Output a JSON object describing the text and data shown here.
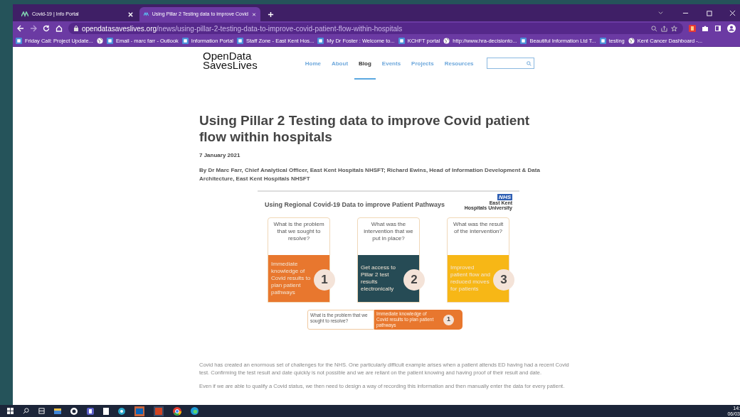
{
  "browser": {
    "tabs": [
      {
        "title": "Covid-19 | Info Portal",
        "selected": false
      },
      {
        "title": "Using Pillar 2 Testing data to improve Covid",
        "selected": true
      }
    ],
    "url": {
      "domain": "opendatasaveslives.org",
      "path": "/news/using-pillar-2-testing-data-to-improve-covid-patient-flow-within-hospitals"
    },
    "bookmarks": [
      {
        "kind": "site",
        "label": "Friday Call: Project Update..."
      },
      {
        "kind": "globe"
      },
      {
        "kind": "site",
        "label": "Email - marc farr - Outlook"
      },
      {
        "kind": "site",
        "label": "Information Portal"
      },
      {
        "kind": "site",
        "label": "Staff Zone - East Kent Hos..."
      },
      {
        "kind": "site",
        "label": "My Dr Foster : Welcome to..."
      },
      {
        "kind": "site",
        "label": "KCHFT portal"
      },
      {
        "kind": "globe",
        "label": "http://www.hra-decisionto..."
      },
      {
        "kind": "site",
        "label": "Beautiful Information Ltd T..."
      },
      {
        "kind": "site",
        "label": "testing"
      },
      {
        "kind": "globe",
        "label": "Kent Cancer Dashboard -..."
      }
    ]
  },
  "site": {
    "logo": {
      "line1": "OpenData",
      "line2": "SavesLives"
    },
    "nav": [
      {
        "label": "Home",
        "selected": false
      },
      {
        "label": "About",
        "selected": false
      },
      {
        "label": "Blog",
        "selected": true
      },
      {
        "label": "Events",
        "selected": false
      },
      {
        "label": "Projects",
        "selected": false
      },
      {
        "label": "Resources",
        "selected": false
      }
    ]
  },
  "article": {
    "title": "Using Pillar 2 Testing data to improve Covid patient flow within hospitals",
    "date": "7 January 2021",
    "byline": "By Dr Marc Farr, Chief Analytical Officer, East Kent Hospitals NHSFT; Richard Ewins, Head of Information Development & Data Architecture, East Kent Hospitals NHSFT",
    "infographic": {
      "title": "Using Regional Covid-19 Data to improve Patient Pathways",
      "badge": "NHS",
      "org": [
        "East Kent",
        "Hospitals University"
      ],
      "cards": [
        {
          "question": "What is the problem that we sought to resolve?",
          "answer": "Immediate knowledge of Covid results to plan patient pathways",
          "number": "1",
          "color": "#e8772e"
        },
        {
          "question": "What was the intervention that we put in place?",
          "answer": "Get access to Pillar 2 test results electronically",
          "number": "2",
          "color": "#264b55"
        },
        {
          "question": "What was the result of the intervention?",
          "answer": "Improved patient flow and reduced moves for patients",
          "number": "3",
          "color": "#f7b716"
        }
      ],
      "summary": {
        "question": "What is the problem that we sought to resolve?",
        "answer": "Immediate knowledge of Covid results to plan patient pathways",
        "number": "1"
      }
    },
    "paragraphs": [
      "Covid has created an enormous set of challenges for the NHS.  One particularly difficult example arises when a patient attends ED having had a recent Covid test. Confirming the test result and date quickly is not possible and we are reliant on the patient knowing and having proof of their result and date.",
      "Even if we are able to qualify a Covid status, we then need to design a way of recording this information and then manually enter the data for every patient."
    ]
  },
  "taskbar": {
    "time": "14:",
    "date": "06/03"
  }
}
